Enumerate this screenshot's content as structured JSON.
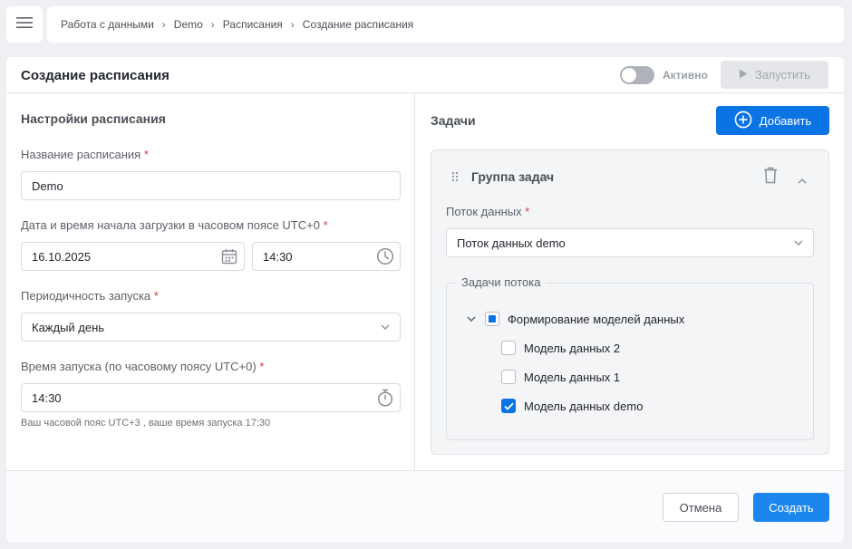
{
  "breadcrumb": {
    "items": [
      "Работа с данными",
      "Demo",
      "Расписания",
      "Создание расписания"
    ],
    "separator": "›"
  },
  "header": {
    "title": "Создание расписания",
    "toggle_label": "Активно",
    "toggle_on": false,
    "run_label": "Запустить"
  },
  "settings": {
    "section_title": "Настройки расписания",
    "name_label": "Название расписания",
    "name_value": "Demo",
    "datetime_label": "Дата и время начала загрузки в часовом поясе UTC+0",
    "date_value": "16.10.2025",
    "time_value": "14:30",
    "period_label": "Периодичность запуска",
    "period_value": "Каждый день",
    "launch_time_label": "Время запуска (по часовому поясу UTC+0)",
    "launch_time_value": "14:30",
    "timezone_hint": "Ваш часовой пояс UTC+3 , ваше время запуска 17:30",
    "required_mark": "*"
  },
  "tasks": {
    "section_title": "Задачи",
    "add_label": "Добавить",
    "group_title": "Группа задач",
    "flow_label": "Поток данных",
    "flow_value": "Поток данных demo",
    "flow_tasks_label": "Задачи потока",
    "tree": {
      "parent": {
        "label": "Формирование моделей данных",
        "state": "indeterminate"
      },
      "children": [
        {
          "label": "Модель данных 2",
          "checked": false
        },
        {
          "label": "Модель данных 1",
          "checked": false
        },
        {
          "label": "Модель данных demo",
          "checked": true
        }
      ]
    }
  },
  "footer": {
    "cancel_label": "Отмена",
    "create_label": "Создать"
  },
  "colors": {
    "primary": "#0b74e5",
    "required": "#d93a3a",
    "background": "#eef0f3"
  },
  "icons": {
    "menu": "hamburger-icon",
    "calendar": "calendar-icon",
    "clock": "clock-icon",
    "stopwatch": "stopwatch-icon",
    "chevron": "chevron-down-icon",
    "play": "play-icon",
    "plus": "plus-circle-icon",
    "drag": "drag-handle-icon",
    "trash": "trash-icon",
    "collapse": "chevron-up-icon"
  }
}
